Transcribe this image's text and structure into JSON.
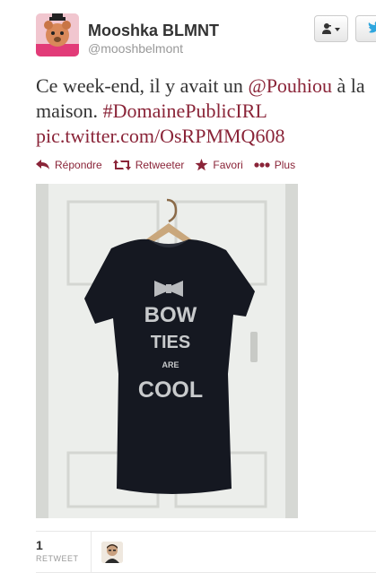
{
  "author": {
    "display_name": "Mooshka BLMNT",
    "handle": "@mooshbelmont"
  },
  "header_buttons": {
    "follow_icon": "user-follow-icon",
    "bird_icon": "twitter-bird-icon"
  },
  "tweet": {
    "text_1": "Ce week-end, il y avait un ",
    "mention": "@Pouhiou",
    "text_2": " à la maison. ",
    "hashtag": "#DomainePublicIRL",
    "text_3": " ",
    "link": "pic.twitter.com/OsRPMMQ608"
  },
  "actions": {
    "reply": "Répondre",
    "retweet": "Retweeter",
    "favorite": "Favori",
    "more": "Plus"
  },
  "photo": {
    "shirt_line1": "BOW",
    "shirt_line2": "TIES",
    "shirt_line3": "ARE",
    "shirt_line4": "COOL"
  },
  "stats": {
    "retweet_count": "1",
    "retweet_label": "RETWEET"
  },
  "colors": {
    "link": "#8a2438",
    "text": "#333333",
    "muted": "#999999"
  }
}
